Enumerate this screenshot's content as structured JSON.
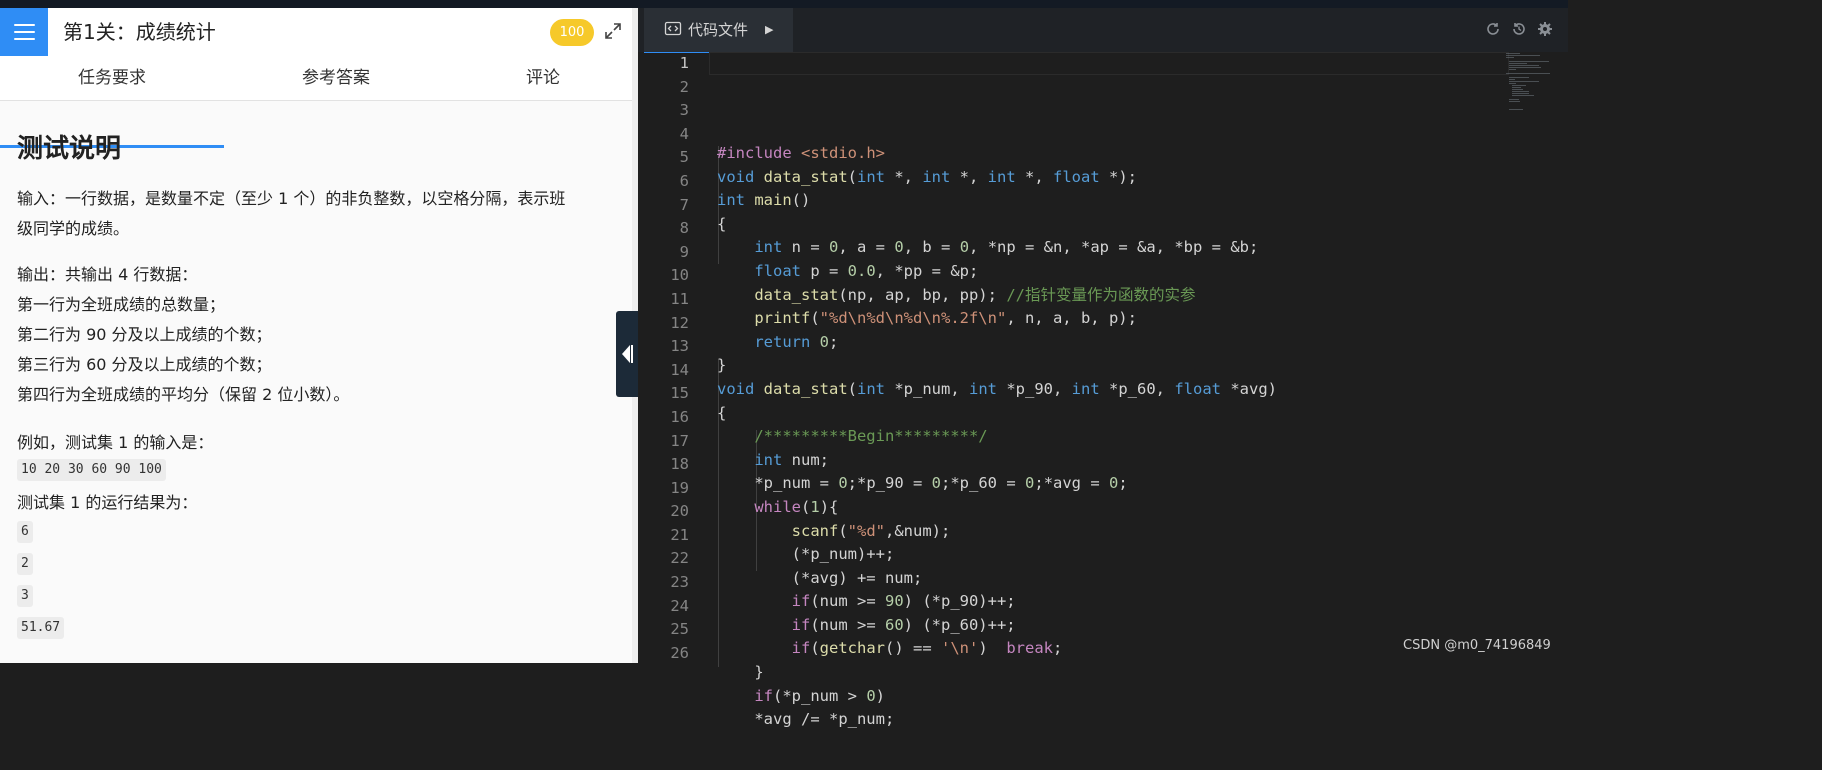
{
  "header": {
    "title": "第1关：成绩统计",
    "score": "100"
  },
  "tabs": [
    {
      "label": "任务要求"
    },
    {
      "label": "参考答案"
    },
    {
      "label": "评论"
    }
  ],
  "content": {
    "heading": "测试说明",
    "input_desc_1": "输入：一行数据，是数量不定（至少 1 个）的非负整数，以空格分隔，表示班",
    "input_desc_2": "级同学的成绩。",
    "output_desc": [
      "输出：共输出 4 行数据：",
      "第一行为全班成绩的总数量；",
      "第二行为 90 分及以上成绩的个数；",
      "第三行为 60 分及以上成绩的个数；",
      "第四行为全班成绩的平均分（保留 2 位小数）。"
    ],
    "example_label": "例如，测试集 1 的输入是：",
    "example_input": "10 20 30 60 90 100",
    "result_label": "测试集 1 的运行结果为：",
    "result_lines": [
      "6",
      "2",
      "3",
      "51.67"
    ]
  },
  "editor": {
    "tab_label": "代码文件",
    "line_numbers": [
      "1",
      "2",
      "3",
      "4",
      "5",
      "6",
      "7",
      "8",
      "9",
      "10",
      "11",
      "12",
      "13",
      "14",
      "15",
      "16",
      "17",
      "18",
      "19",
      "20",
      "21",
      "22",
      "23",
      "24",
      "25",
      "26"
    ],
    "code_lines": [
      "#include <stdio.h>",
      "void data_stat(int *, int *, int *, float *);",
      "int main()",
      "{",
      "    int n = 0, a = 0, b = 0, *np = &n, *ap = &a, *bp = &b;",
      "    float p = 0.0, *pp = &p;",
      "    data_stat(np, ap, bp, pp); //指针变量作为函数的实参",
      "    printf(\"%d\\n%d\\n%d\\n%.2f\\n\", n, a, b, p);",
      "    return 0;",
      "}",
      "void data_stat(int *p_num, int *p_90, int *p_60, float *avg)",
      "{",
      "    /*********Begin*********/",
      "    int num;",
      "    *p_num = 0;*p_90 = 0;*p_60 = 0;*avg = 0;",
      "    while(1){",
      "        scanf(\"%d\",&num);",
      "        (*p_num)++;",
      "        (*avg) += num;",
      "        if(num >= 90) (*p_90)++;",
      "        if(num >= 60) (*p_60)++;",
      "        if(getchar() == '\\n')  break;",
      "    }",
      "    if(*p_num > 0)",
      "    *avg /= *p_num;",
      ""
    ]
  },
  "watermark": "CSDN @m0_74196849",
  "colors": {
    "accent": "#2f8df5",
    "score_badge": "#f6c92a",
    "editor_bg": "#1e1e1e"
  },
  "icons": [
    "menu-icon",
    "expand-icon",
    "collapse-panel-icon",
    "code-file-icon",
    "refresh-icon",
    "reset-icon",
    "settings-icon"
  ]
}
